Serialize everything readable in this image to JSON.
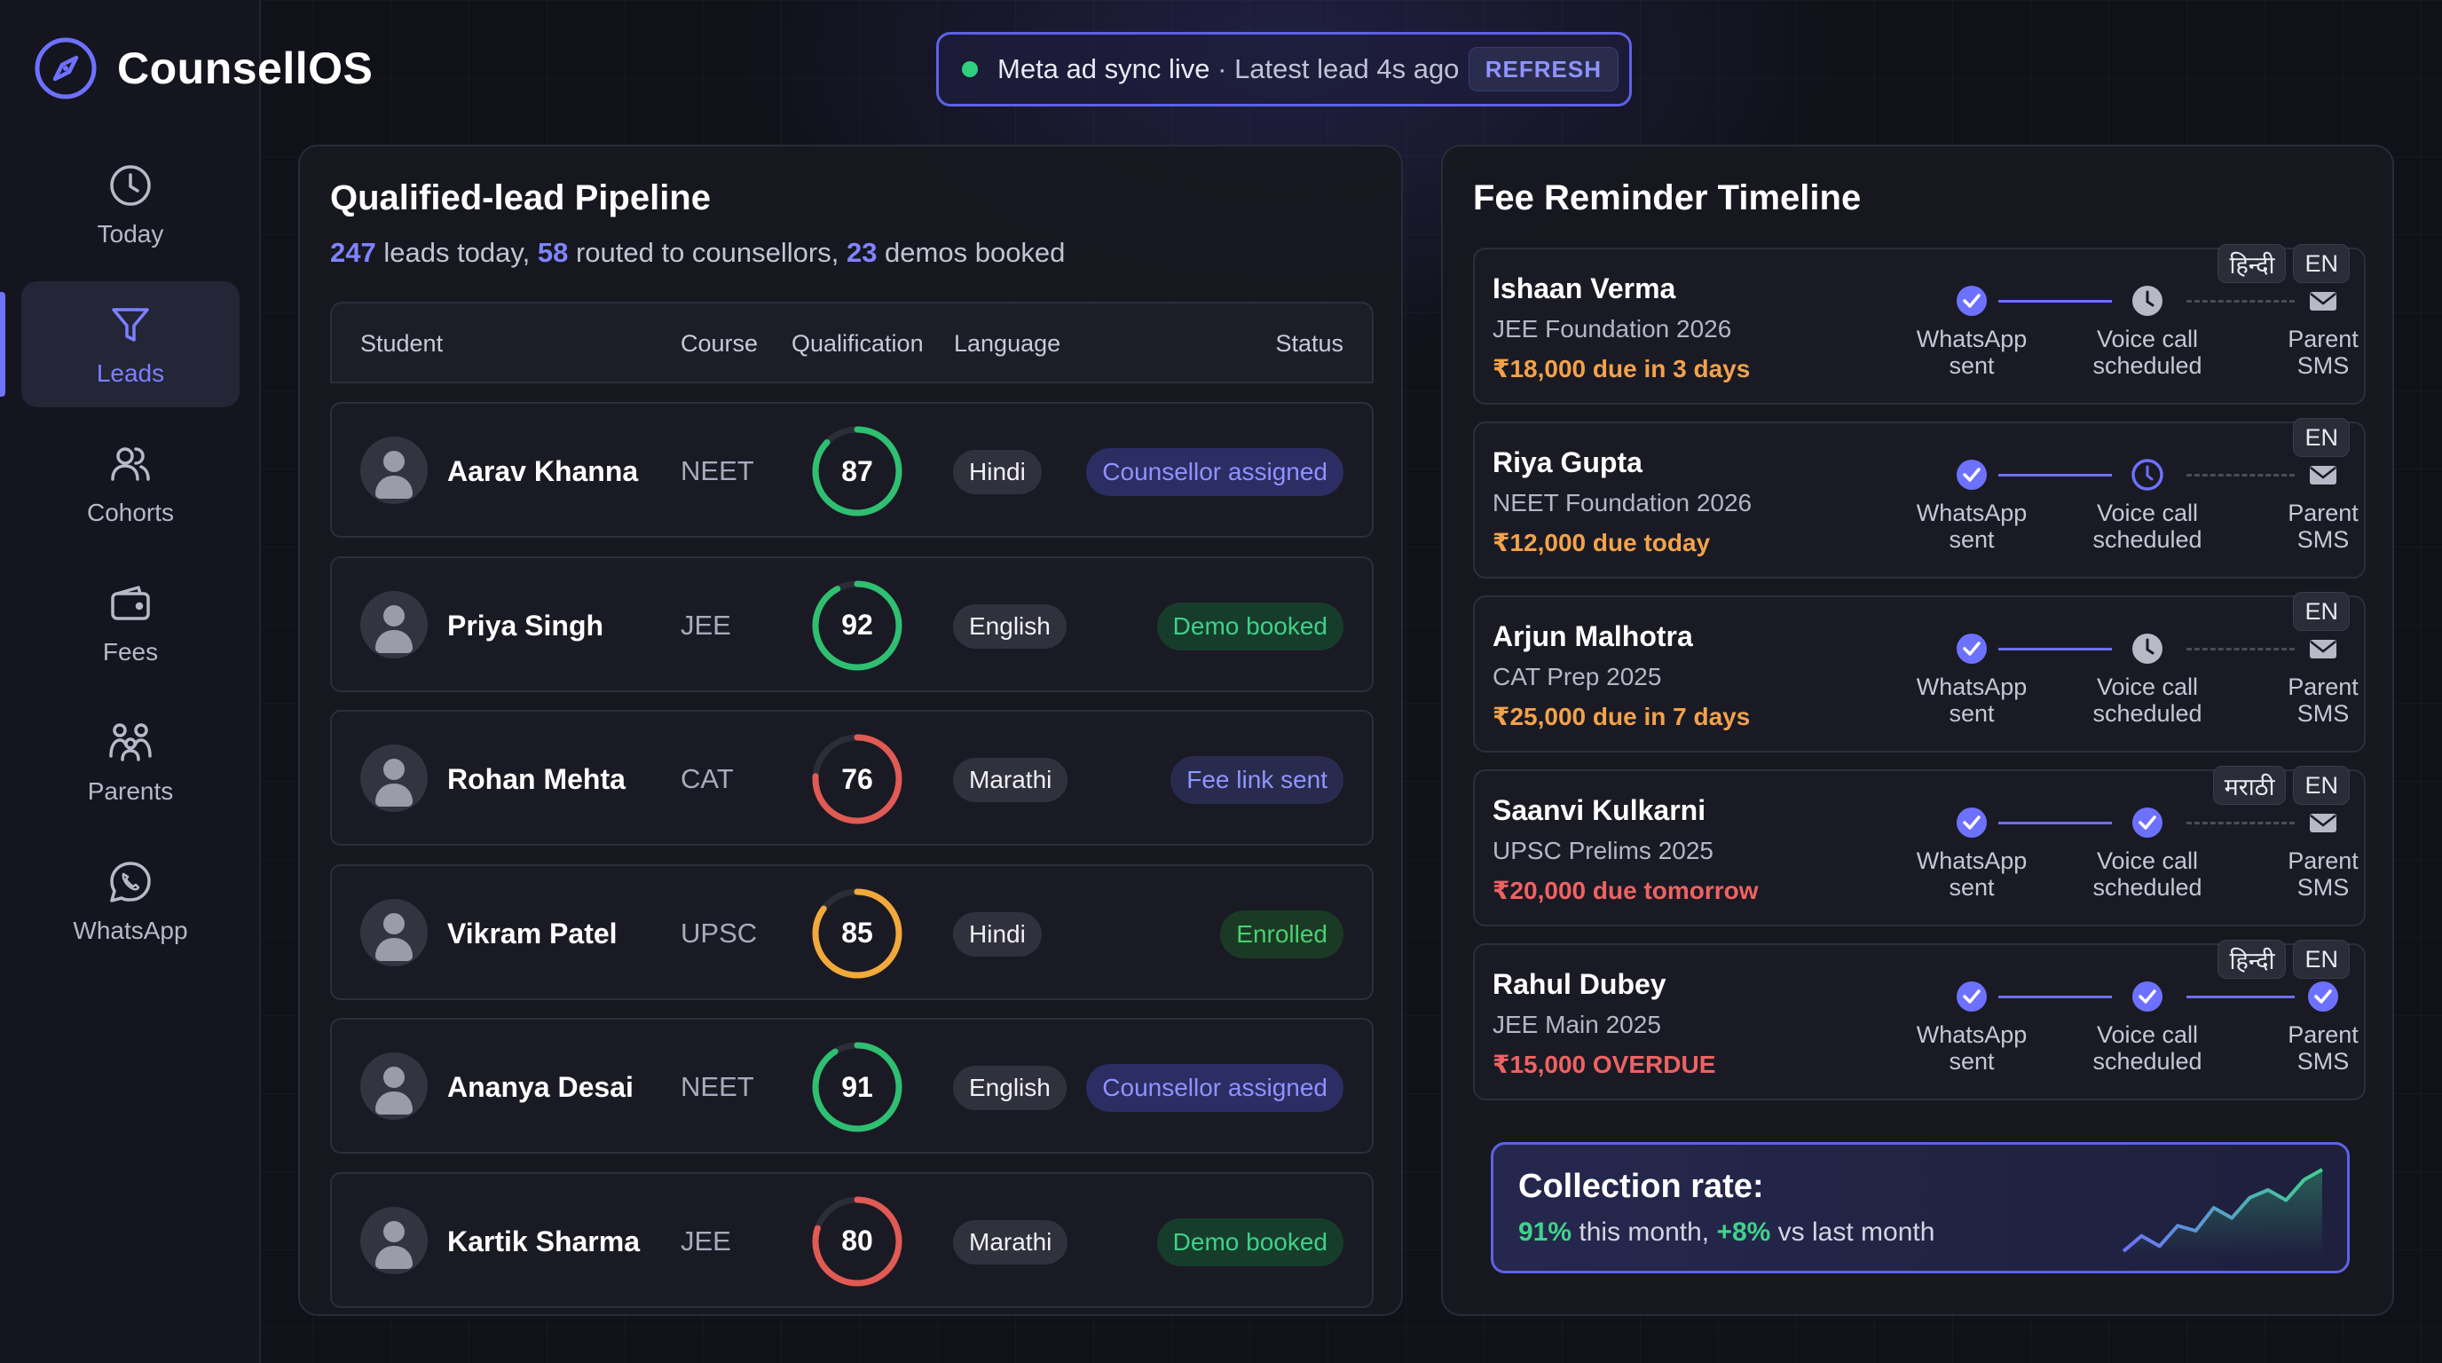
{
  "brand": {
    "name": "CounsellOS"
  },
  "nav": [
    {
      "label": "Today",
      "icon": "clock-icon",
      "active": false
    },
    {
      "label": "Leads",
      "icon": "filter-icon",
      "active": true
    },
    {
      "label": "Cohorts",
      "icon": "users-icon",
      "active": false
    },
    {
      "label": "Fees",
      "icon": "wallet-icon",
      "active": false
    },
    {
      "label": "Parents",
      "icon": "family-icon",
      "active": false
    },
    {
      "label": "WhatsApp",
      "icon": "whatsapp-icon",
      "active": false
    }
  ],
  "status": {
    "text": "Meta ad sync live",
    "separator": " · ",
    "sub": "Latest lead 4s ago",
    "refresh_label": "REFRESH"
  },
  "pipeline": {
    "title": "Qualified-lead Pipeline",
    "stats": {
      "leads": "247",
      "leads_text": " leads today, ",
      "routed": "58",
      "routed_text": " routed to counsellors, ",
      "demos": "23",
      "demos_text": " demos booked"
    },
    "columns": {
      "student": "Student",
      "course": "Course",
      "qualification": "Qualification",
      "language": "Language",
      "status": "Status"
    },
    "rows": [
      {
        "name": "Aarav Khanna",
        "course": "NEET",
        "score": "87",
        "score_pct": 87,
        "score_color": "#2fbf71",
        "language": "Hindi",
        "status": "Counsellor assigned",
        "status_kind": "counsellor"
      },
      {
        "name": "Priya Singh",
        "course": "JEE",
        "score": "92",
        "score_pct": 92,
        "score_color": "#2fbf71",
        "language": "English",
        "status": "Demo booked",
        "status_kind": "demo"
      },
      {
        "name": "Rohan Mehta",
        "course": "CAT",
        "score": "76",
        "score_pct": 76,
        "score_color": "#e15a54",
        "language": "Marathi",
        "status": "Fee link sent",
        "status_kind": "fee"
      },
      {
        "name": "Vikram Patel",
        "course": "UPSC",
        "score": "85",
        "score_pct": 85,
        "score_color": "#f2a93b",
        "language": "Hindi",
        "status": "Enrolled",
        "status_kind": "enrolled"
      },
      {
        "name": "Ananya Desai",
        "course": "NEET",
        "score": "91",
        "score_pct": 91,
        "score_color": "#2fbf71",
        "language": "English",
        "status": "Counsellor assigned",
        "status_kind": "counsellor"
      },
      {
        "name": "Kartik Sharma",
        "course": "JEE",
        "score": "80",
        "score_pct": 80,
        "score_color": "#e15a54",
        "language": "Marathi",
        "status": "Demo booked",
        "status_kind": "demo"
      }
    ]
  },
  "fees": {
    "title": "Fee Reminder Timeline",
    "step_labels": {
      "whatsapp": [
        "WhatsApp",
        "sent"
      ],
      "voice": [
        "Voice call",
        "scheduled"
      ],
      "sms": [
        "Parent",
        "SMS"
      ]
    },
    "cards": [
      {
        "name": "Ishaan Verma",
        "course": "JEE Foundation 2026",
        "due": "₹18,000 due in 3 days",
        "due_kind": "amber",
        "langs": [
          "हिन्दी",
          "EN"
        ],
        "whatsapp": "done",
        "voice": "pending",
        "sms": "pending"
      },
      {
        "name": "Riya Gupta",
        "course": "NEET Foundation 2026",
        "due": "₹12,000 due today",
        "due_kind": "amber",
        "langs": [
          "EN"
        ],
        "whatsapp": "done",
        "voice": "active",
        "sms": "pending"
      },
      {
        "name": "Arjun Malhotra",
        "course": "CAT Prep 2025",
        "due": "₹25,000 due in 7 days",
        "due_kind": "amber",
        "langs": [
          "EN"
        ],
        "whatsapp": "done",
        "voice": "pending",
        "sms": "pending"
      },
      {
        "name": "Saanvi Kulkarni",
        "course": "UPSC Prelims 2025",
        "due": "₹20,000 due tomorrow",
        "due_kind": "red",
        "langs": [
          "मराठी",
          "EN"
        ],
        "whatsapp": "done",
        "voice": "done",
        "sms": "pending"
      },
      {
        "name": "Rahul Dubey",
        "course": "JEE Main 2025",
        "due": "₹15,000 OVERDUE",
        "due_kind": "red",
        "langs": [
          "हिन्दी",
          "EN"
        ],
        "whatsapp": "done",
        "voice": "done",
        "sms": "done"
      }
    ],
    "collection": {
      "title": "Collection rate:",
      "rate": "91%",
      "rate_text": " this month, ",
      "delta": "+8%",
      "delta_text": " vs last month",
      "trend": [
        10,
        22,
        14,
        30,
        26,
        44,
        36,
        52,
        58,
        50,
        66,
        74
      ]
    }
  },
  "colors": {
    "accent": "#6d71ff",
    "green": "#2fbf71",
    "amber": "#f2a93b",
    "red": "#e15a54"
  }
}
